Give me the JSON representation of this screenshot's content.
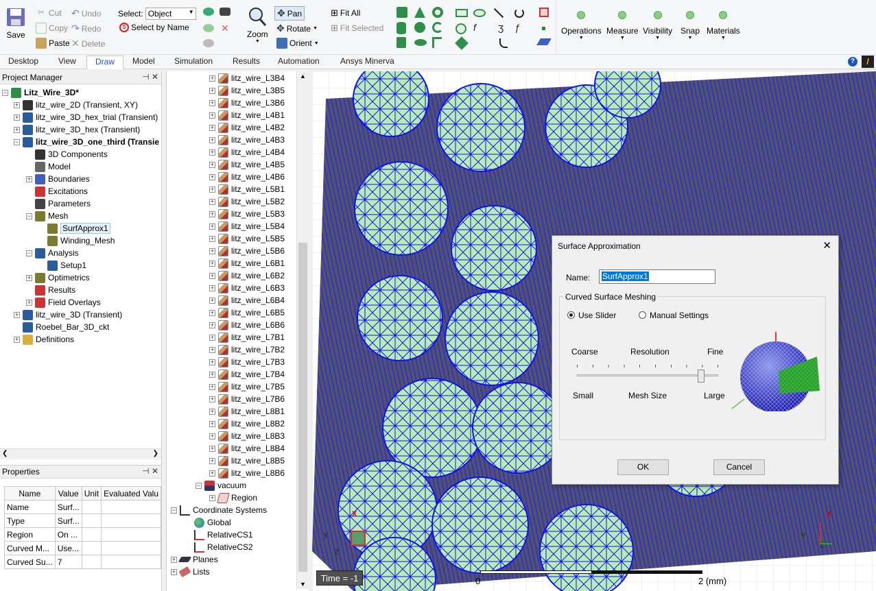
{
  "ribbon": {
    "save": "Save",
    "cut": "Cut",
    "copy": "Copy",
    "paste": "Paste",
    "undo": "Undo",
    "redo": "Redo",
    "delete": "Delete",
    "select_label": "Select:",
    "select_value": "Object",
    "select_by_name": "Select by Name",
    "zoom": "Zoom",
    "pan": "Pan",
    "rotate": "Rotate",
    "orient": "Orient",
    "fit_all": "Fit All",
    "fit_selected": "Fit Selected",
    "operations": "Operations",
    "measure": "Measure",
    "visibility": "Visibility",
    "snap": "Snap",
    "materials": "Materials"
  },
  "tabs": [
    "Desktop",
    "View",
    "Draw",
    "Model",
    "Simulation",
    "Results",
    "Automation",
    "Ansys Minerva"
  ],
  "project_manager": {
    "title": "Project Manager",
    "items": [
      {
        "label": "Litz_Wire_3D*",
        "bold": true
      },
      {
        "label": "litz_wire_2D (Transient, XY)"
      },
      {
        "label": "litz_wire_3D_hex_trial (Transient)"
      },
      {
        "label": "litz_wire_3D_hex (Transient)"
      },
      {
        "label": "litz_wire_3D_one_third (Transie",
        "bold": true
      },
      {
        "label": "3D Components"
      },
      {
        "label": "Model"
      },
      {
        "label": "Boundaries"
      },
      {
        "label": "Excitations"
      },
      {
        "label": "Parameters"
      },
      {
        "label": "Mesh"
      },
      {
        "label": "SurfApprox1"
      },
      {
        "label": "Winding_Mesh"
      },
      {
        "label": "Analysis"
      },
      {
        "label": "Setup1"
      },
      {
        "label": "Optimetrics"
      },
      {
        "label": "Results"
      },
      {
        "label": "Field Overlays"
      },
      {
        "label": "litz_wire_3D (Transient)"
      },
      {
        "label": "Roebel_Bar_3D_ckt"
      },
      {
        "label": "Definitions"
      }
    ]
  },
  "properties": {
    "title": "Properties",
    "headers": [
      "Name",
      "Value",
      "Unit",
      "Evaluated Valu"
    ],
    "rows": [
      [
        "Name",
        "Surf...",
        "",
        ""
      ],
      [
        "Type",
        "Surf...",
        "",
        ""
      ],
      [
        "Region",
        "On ...",
        "",
        ""
      ],
      [
        "Curved M...",
        "Use...",
        "",
        ""
      ],
      [
        "Curved Su...",
        "7",
        "",
        ""
      ]
    ]
  },
  "model_tree": {
    "wires": [
      "litz_wire_L3B4",
      "litz_wire_L3B5",
      "litz_wire_L3B6",
      "litz_wire_L4B1",
      "litz_wire_L4B2",
      "litz_wire_L4B3",
      "litz_wire_L4B4",
      "litz_wire_L4B5",
      "litz_wire_L4B6",
      "litz_wire_L5B1",
      "litz_wire_L5B2",
      "litz_wire_L5B3",
      "litz_wire_L5B4",
      "litz_wire_L5B5",
      "litz_wire_L5B6",
      "litz_wire_L6B1",
      "litz_wire_L6B2",
      "litz_wire_L6B3",
      "litz_wire_L6B4",
      "litz_wire_L6B5",
      "litz_wire_L6B6",
      "litz_wire_L7B1",
      "litz_wire_L7B2",
      "litz_wire_L7B3",
      "litz_wire_L7B4",
      "litz_wire_L7B5",
      "litz_wire_L7B6",
      "litz_wire_L8B1",
      "litz_wire_L8B2",
      "litz_wire_L8B3",
      "litz_wire_L8B4",
      "litz_wire_L8B5",
      "litz_wire_L8B6"
    ],
    "vacuum": "vacuum",
    "region": "Region",
    "coord_systems": "Coordinate Systems",
    "global": "Global",
    "relcs1": "RelativeCS1",
    "relcs2": "RelativeCS2",
    "planes": "Planes",
    "lists": "Lists"
  },
  "viewport": {
    "time": "Time = -1",
    "scale_zero": "0",
    "scale_max": "2 (mm)",
    "axis_x": "X",
    "axis_y": "Y",
    "axis_z": "Z"
  },
  "dialog": {
    "title": "Surface Approximation",
    "name_label": "Name:",
    "name_value": "SurfApprox1",
    "group_label": "Curved Surface Meshing",
    "use_slider": "Use Slider",
    "manual_settings": "Manual Settings",
    "coarse": "Coarse",
    "resolution": "Resolution",
    "fine": "Fine",
    "small": "Small",
    "mesh_size": "Mesh Size",
    "large": "Large",
    "slider_position": 0.88,
    "ok": "OK",
    "cancel": "Cancel"
  },
  "colors": {
    "accent": "#1a56b8",
    "mesh": "#1010e0",
    "mesh_fill": "#b7ecb7"
  }
}
